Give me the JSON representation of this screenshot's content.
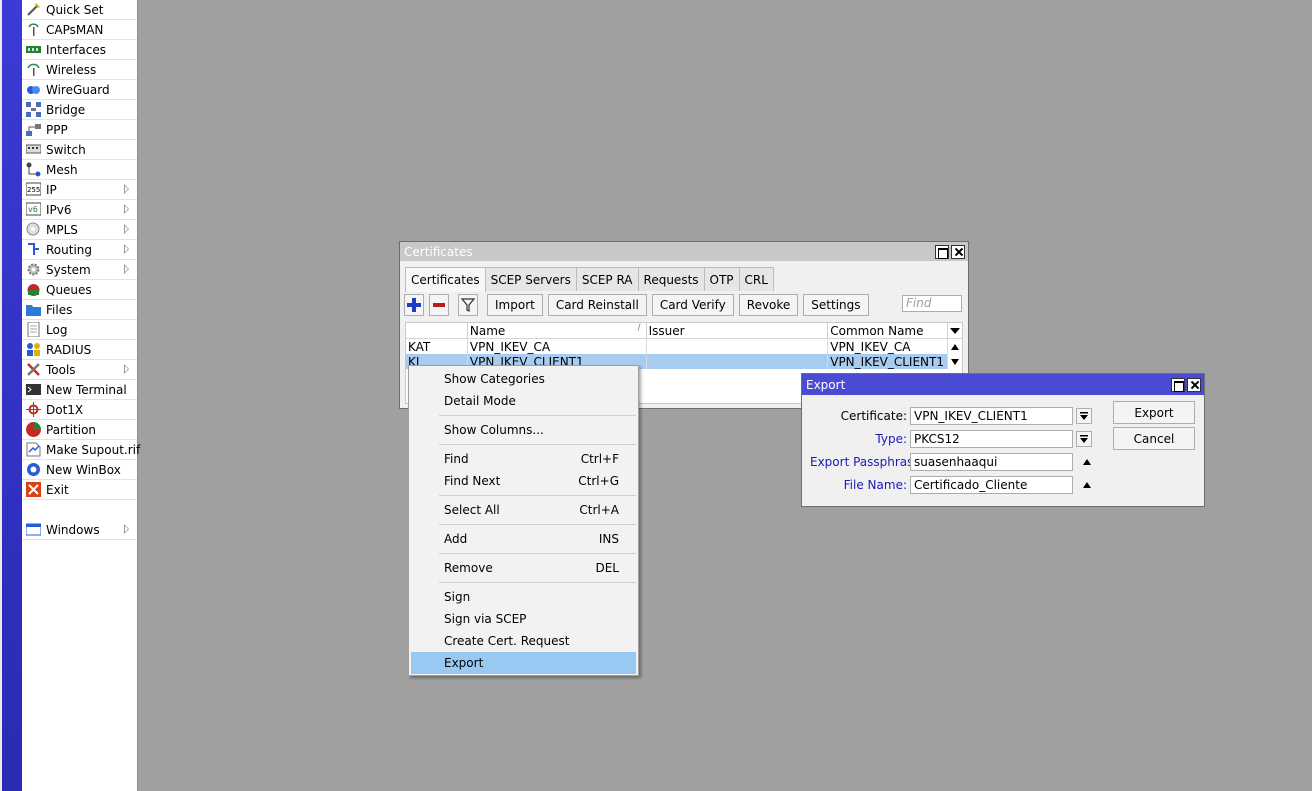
{
  "sidebar": {
    "items": [
      {
        "label": "Quick Set",
        "icon": "wand-icon",
        "arrow": false
      },
      {
        "label": "CAPsMAN",
        "icon": "antenna-icon",
        "arrow": false
      },
      {
        "label": "Interfaces",
        "icon": "interfaces-icon",
        "arrow": false
      },
      {
        "label": "Wireless",
        "icon": "wireless-icon",
        "arrow": false
      },
      {
        "label": "WireGuard",
        "icon": "wireguard-icon",
        "arrow": false
      },
      {
        "label": "Bridge",
        "icon": "bridge-icon",
        "arrow": false
      },
      {
        "label": "PPP",
        "icon": "ppp-icon",
        "arrow": false
      },
      {
        "label": "Switch",
        "icon": "switch-icon",
        "arrow": false
      },
      {
        "label": "Mesh",
        "icon": "mesh-icon",
        "arrow": false
      },
      {
        "label": "IP",
        "icon": "ip-icon",
        "arrow": true
      },
      {
        "label": "IPv6",
        "icon": "ipv6-icon",
        "arrow": true
      },
      {
        "label": "MPLS",
        "icon": "mpls-icon",
        "arrow": true
      },
      {
        "label": "Routing",
        "icon": "routing-icon",
        "arrow": true
      },
      {
        "label": "System",
        "icon": "gear-icon",
        "arrow": true
      },
      {
        "label": "Queues",
        "icon": "queues-icon",
        "arrow": false
      },
      {
        "label": "Files",
        "icon": "folder-icon",
        "arrow": false
      },
      {
        "label": "Log",
        "icon": "log-icon",
        "arrow": false
      },
      {
        "label": "RADIUS",
        "icon": "radius-icon",
        "arrow": false
      },
      {
        "label": "Tools",
        "icon": "tools-icon",
        "arrow": true
      },
      {
        "label": "New Terminal",
        "icon": "terminal-icon",
        "arrow": false
      },
      {
        "label": "Dot1X",
        "icon": "dot1x-icon",
        "arrow": false
      },
      {
        "label": "Partition",
        "icon": "partition-icon",
        "arrow": false
      },
      {
        "label": "Make Supout.rif",
        "icon": "supout-icon",
        "arrow": false
      },
      {
        "label": "New WinBox",
        "icon": "winbox-icon",
        "arrow": false
      },
      {
        "label": "Exit",
        "icon": "exit-icon",
        "arrow": false
      }
    ],
    "windows": {
      "label": "Windows",
      "icon": "windows-icon"
    }
  },
  "certificates": {
    "title": "Certificates",
    "tabs": [
      "Certificates",
      "SCEP Servers",
      "SCEP RA",
      "Requests",
      "OTP",
      "CRL"
    ],
    "toolbar": {
      "import": "Import",
      "card_reinstall": "Card Reinstall",
      "card_verify": "Card Verify",
      "revoke": "Revoke",
      "settings": "Settings",
      "find_placeholder": "Find"
    },
    "columns": [
      "",
      "Name",
      "Issuer",
      "Common Name"
    ],
    "rows": [
      {
        "flags": "KAT",
        "name": "VPN_IKEV_CA",
        "issuer": "",
        "common_name": "VPN_IKEV_CA"
      },
      {
        "flags": "KI",
        "name": "VPN_IKEV_CLIENT1",
        "issuer": "",
        "common_name": "VPN_IKEV_CLIENT1"
      }
    ]
  },
  "context_menu": {
    "groups": [
      [
        {
          "label": "Show Categories",
          "shortcut": ""
        },
        {
          "label": "Detail Mode",
          "shortcut": ""
        }
      ],
      [
        {
          "label": "Show Columns...",
          "shortcut": ""
        }
      ],
      [
        {
          "label": "Find",
          "shortcut": "Ctrl+F"
        },
        {
          "label": "Find Next",
          "shortcut": "Ctrl+G"
        }
      ],
      [
        {
          "label": "Select All",
          "shortcut": "Ctrl+A"
        }
      ],
      [
        {
          "label": "Add",
          "shortcut": "INS"
        }
      ],
      [
        {
          "label": "Remove",
          "shortcut": "DEL"
        }
      ],
      [
        {
          "label": "Sign",
          "shortcut": ""
        },
        {
          "label": "Sign via SCEP",
          "shortcut": ""
        },
        {
          "label": "Create Cert. Request",
          "shortcut": ""
        },
        {
          "label": "Export",
          "shortcut": "",
          "highlighted": true
        }
      ]
    ]
  },
  "export_dialog": {
    "title": "Export",
    "certificate_label": "Certificate:",
    "certificate_value": "VPN_IKEV_CLIENT1",
    "type_label": "Type:",
    "type_value": "PKCS12",
    "passphrase_label": "Export Passphrase:",
    "passphrase_value": "suasenhaaqui",
    "filename_label": "File Name:",
    "filename_value": "Certificado_Cliente",
    "export_button": "Export",
    "cancel_button": "Cancel"
  },
  "colors": {
    "desktop": "#a0a0a0",
    "strip": "#2a2ab4",
    "dialog_title": "#4a4ad2",
    "selection": "#a8ccf0",
    "menu_highlight": "#99c9f3",
    "blue_label": "#1a1ab8"
  }
}
